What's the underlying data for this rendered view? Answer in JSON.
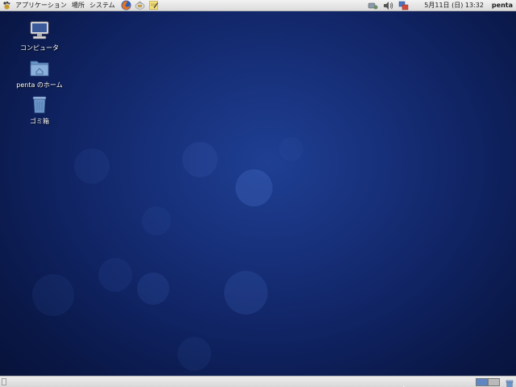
{
  "top_panel": {
    "menus": [
      "アプリケーション",
      "場所",
      "システム"
    ],
    "launchers": [
      "firefox-icon",
      "mail-client-icon",
      "text-editor-icon"
    ],
    "tray": [
      "network-icon",
      "volume-icon",
      "update-notifier-icon"
    ],
    "clock": "5月11日 (日) 13:32",
    "user": "penta"
  },
  "desktop": {
    "icons": [
      {
        "name": "computer-icon",
        "label": "コンピュータ"
      },
      {
        "name": "home-folder-icon",
        "label": "penta のホーム"
      },
      {
        "name": "trash-icon",
        "label": "ゴミ箱"
      }
    ]
  },
  "bottom_panel": {
    "workspaces": 2,
    "active_workspace": 1
  },
  "colors": {
    "desktop_bg": "#142a6e",
    "panel_bg": "#e4e4e4",
    "workspace_active": "#5f86c2"
  }
}
